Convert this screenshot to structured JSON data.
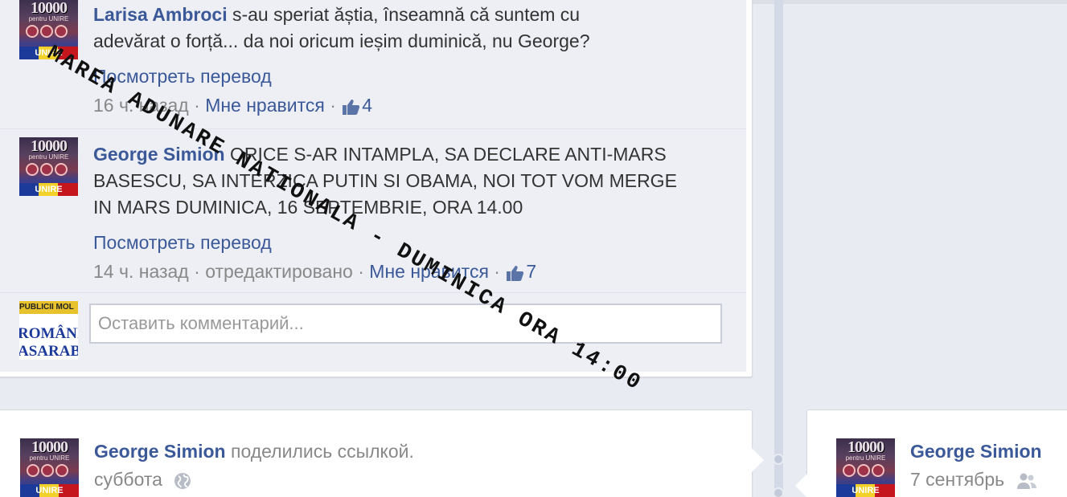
{
  "comments": [
    {
      "author": "Larisa Ambroci",
      "text_line1": "s-au speriat ăștia, înseamnă că suntem cu",
      "text_line2": "adevărat o forță... da noi oricum ieșim duminică, nu George?",
      "translate": "Посмотреть перевод",
      "time": "16 ч. назад",
      "like": "Мне нравится",
      "likes": "4"
    },
    {
      "author": "George Simion",
      "text_line1": "ORICE S-AR INTAMPLA, SA DECLARE ANTI-MARS",
      "text_line2": "BASESCU, SA INTERZICA PUTIN SI OBAMA, NOI TOT VOM MERGE",
      "text_line3": "IN MARS DUMINICA, 16 SEPTEMBRIE, ORA 14.00",
      "translate": "Посмотреть перевод",
      "time": "14 ч. назад",
      "edited": "отредактировано",
      "like": "Мне нравится",
      "likes": "7"
    }
  ],
  "comment_input": {
    "placeholder": "Оставить комментарий..."
  },
  "avatar_labels": {
    "number": "10000",
    "sub": "pentru UNIRE",
    "bottom": "UNIRE"
  },
  "ro_avatar_labels": {
    "top": "PUBLICII MOL",
    "mid": "ROMÂNI",
    "bottom": "ASARABI"
  },
  "card_left": {
    "author": "George Simion",
    "action": "поделились ссылкой.",
    "date": "суббота"
  },
  "card_right": {
    "author": "George Simion",
    "date": "7 сентябрь"
  },
  "watermark": "MAREA ADUNARE NATIONALA - DUMINICA ORA 14:00",
  "colors": {
    "link": "#3b5998",
    "meta": "#888888",
    "background": "#e9ebf2",
    "comment_bg": "#edeff4"
  }
}
